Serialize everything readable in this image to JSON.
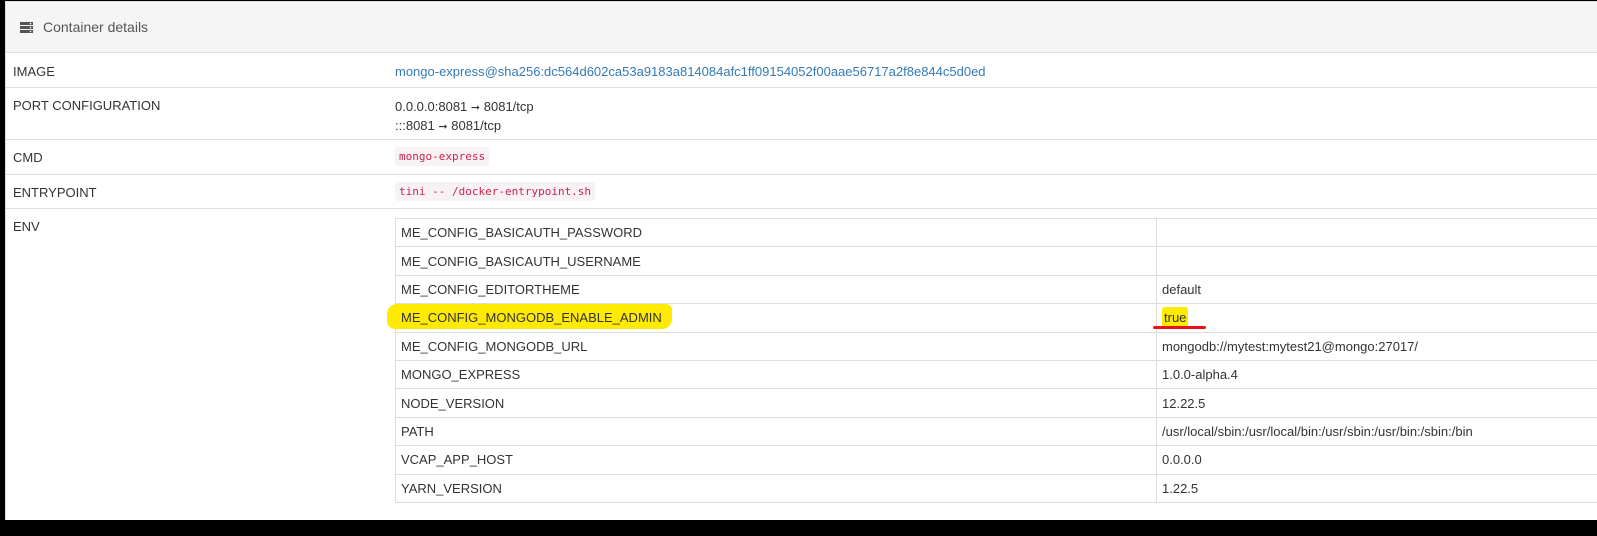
{
  "panel": {
    "icon": "server-icon",
    "title": "Container details"
  },
  "details": {
    "image_label": "IMAGE",
    "image_value": "mongo-express@sha256:dc564d602ca53a9183a814084afc1ff09154052f00aae56717a2f8e844c5d0ed",
    "ports_label": "PORT CONFIGURATION",
    "ports": [
      {
        "host": "0.0.0.0:8081",
        "container": "8081/tcp"
      },
      {
        "host": ":::8081",
        "container": "8081/tcp"
      }
    ],
    "arrow": "➞",
    "cmd_label": "CMD",
    "cmd_value": "mongo-express",
    "entrypoint_label": "ENTRYPOINT",
    "entrypoint_value": "tini -- /docker-entrypoint.sh",
    "env_label": "ENV"
  },
  "env": [
    {
      "key": "ME_CONFIG_BASICAUTH_PASSWORD",
      "value": ""
    },
    {
      "key": "ME_CONFIG_BASICAUTH_USERNAME",
      "value": ""
    },
    {
      "key": "ME_CONFIG_EDITORTHEME",
      "value": "default"
    },
    {
      "key": "ME_CONFIG_MONGODB_ENABLE_ADMIN",
      "value": "true"
    },
    {
      "key": "ME_CONFIG_MONGODB_URL",
      "value": "mongodb://mytest:mytest21@mongo:27017/"
    },
    {
      "key": "MONGO_EXPRESS",
      "value": "1.0.0-alpha.4"
    },
    {
      "key": "NODE_VERSION",
      "value": "12.22.5"
    },
    {
      "key": "PATH",
      "value": "/usr/local/sbin:/usr/local/bin:/usr/sbin:/usr/bin:/sbin:/bin"
    },
    {
      "key": "VCAP_APP_HOST",
      "value": "0.0.0.0"
    },
    {
      "key": "YARN_VERSION",
      "value": "1.22.5"
    }
  ],
  "annotations": {
    "highlight_color": "#ffeb00",
    "underline_color": "#e8101b"
  }
}
